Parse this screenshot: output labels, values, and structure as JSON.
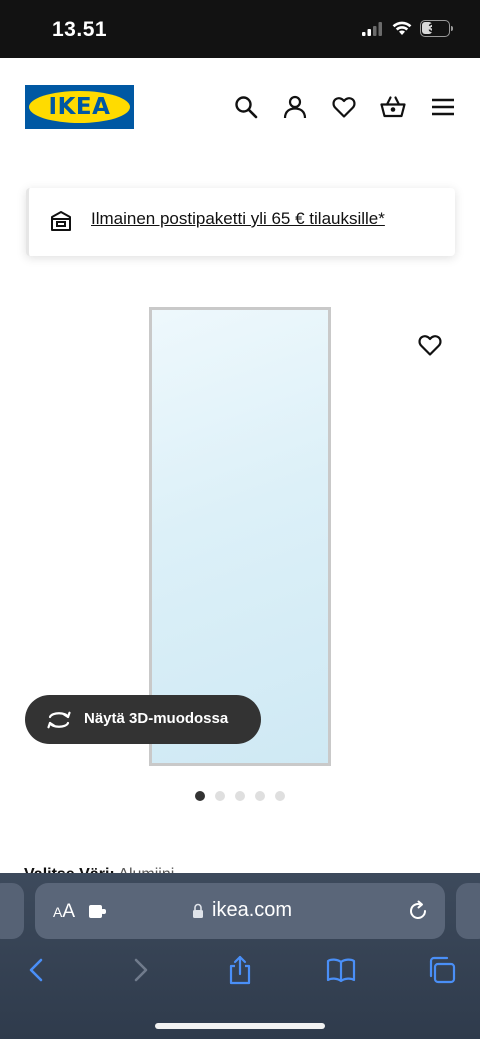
{
  "status_bar": {
    "time": "13.51",
    "battery": "37",
    "battery_level": 0.37
  },
  "header": {
    "logo_text": "IKEA",
    "icons": [
      "search-icon",
      "user-icon",
      "heart-icon",
      "basket-icon",
      "menu-icon"
    ]
  },
  "promo": {
    "icon": "delivery-box-icon",
    "text": "Ilmainen postipaketti yli 65 € tilauksille*"
  },
  "product": {
    "favorite_icon": "heart-outline-icon",
    "view_3d_label": "Näytä 3D-muodossa",
    "view_3d_icon": "rotate-3d-icon",
    "carousel": {
      "total": 5,
      "active": 1
    }
  },
  "peek": {
    "label": "Valitse Väri:",
    "value": "Alumiini"
  },
  "browser": {
    "aa": "AA",
    "url": "ikea.com",
    "icons": [
      "back-icon",
      "forward-icon",
      "share-icon",
      "bookmarks-icon",
      "tabs-icon"
    ]
  },
  "colors": {
    "ikea_blue": "#0058a3",
    "ikea_yellow": "#ffdb00",
    "browser_accent": "#4a8ff7"
  }
}
